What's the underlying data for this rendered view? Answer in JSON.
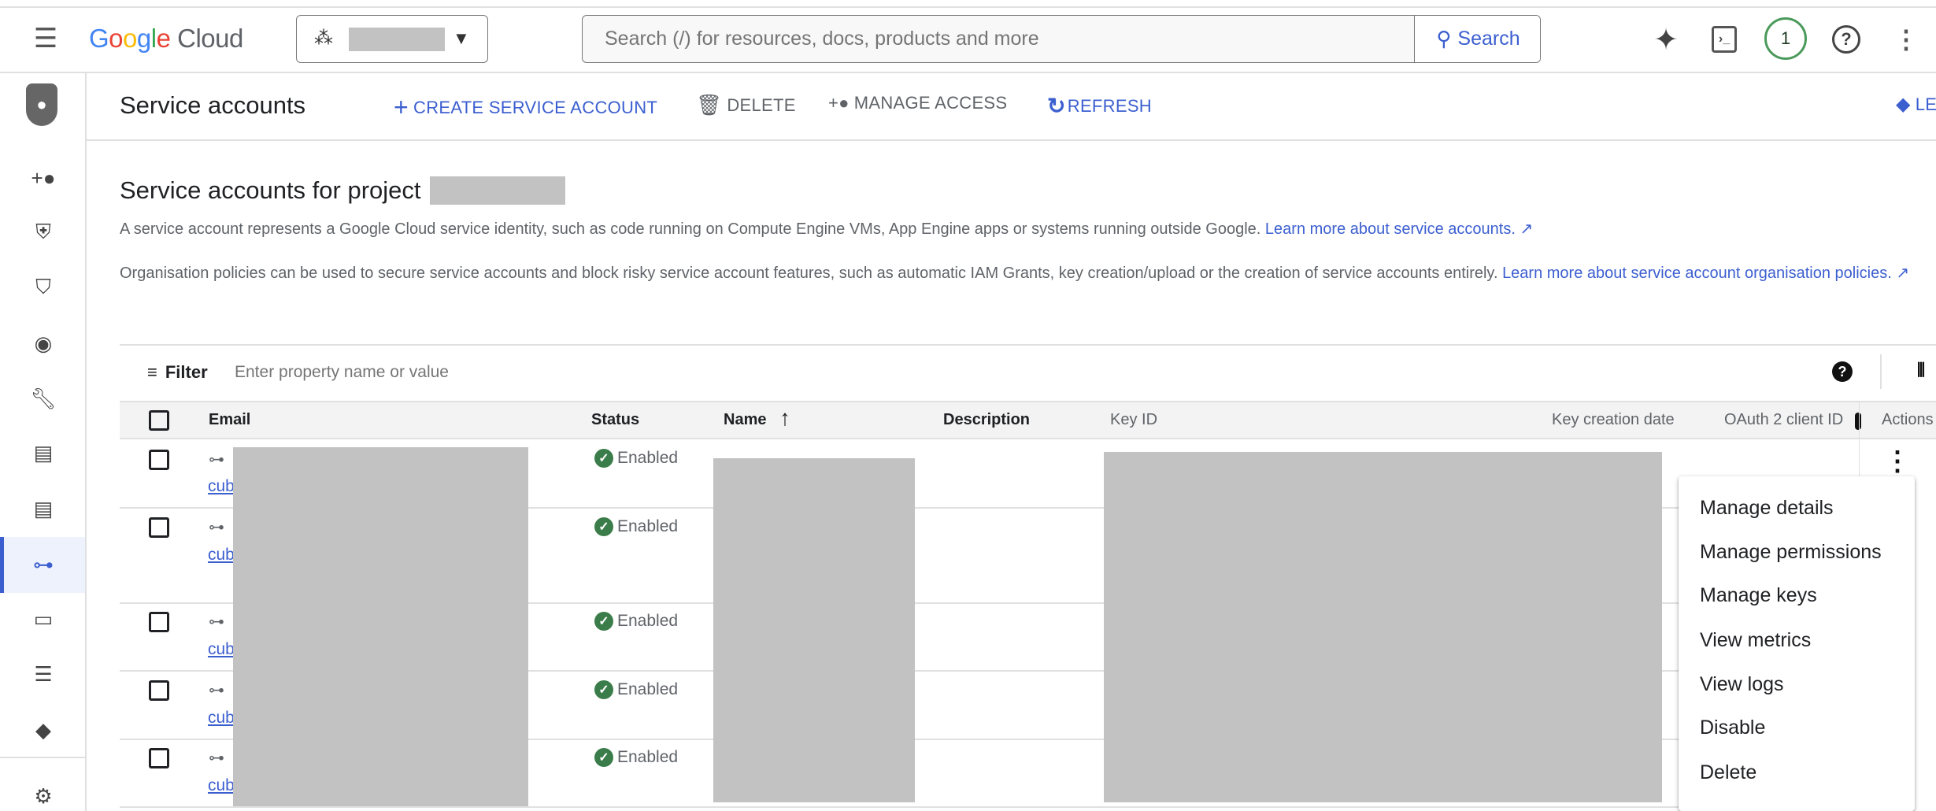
{
  "header": {
    "logo_text": "Google Cloud",
    "search_placeholder": "Search (/) for resources, docs, products and more",
    "search_button": "Search",
    "notification_count": "1"
  },
  "toolbar": {
    "page_title": "Service accounts",
    "create": "CREATE SERVICE ACCOUNT",
    "delete": "DELETE",
    "manage_access": "MANAGE ACCESS",
    "refresh": "REFRESH",
    "learn": "LE"
  },
  "sidebar": {
    "items": [
      {
        "icon": "person-add-icon"
      },
      {
        "icon": "shield-key-icon"
      },
      {
        "icon": "shield-person-icon"
      },
      {
        "icon": "account-circle-icon"
      },
      {
        "icon": "wrench-icon"
      },
      {
        "icon": "document-search-icon"
      },
      {
        "icon": "notes-icon"
      },
      {
        "icon": "service-account-key-icon",
        "active": true
      },
      {
        "icon": "id-card-icon"
      },
      {
        "icon": "list-icon"
      },
      {
        "icon": "tag-icon"
      },
      {
        "icon": "folder-settings-icon"
      }
    ],
    "active_color": "#3c5fd0"
  },
  "main": {
    "heading": "Service accounts for project",
    "para1": "A service account represents a Google Cloud service identity, such as code running on Compute Engine VMs, App Engine apps or systems running outside Google.",
    "para1_link": "Learn more about service accounts.",
    "para2": "Organisation policies can be used to secure service accounts and block risky service account features, such as automatic IAM Grants, key creation/upload or the creation of service accounts entirely.",
    "para2_link_a": "Learn more about service account organisation",
    "para2_link_b": "policies."
  },
  "filter": {
    "label": "Filter",
    "placeholder": "Enter property name or value"
  },
  "table": {
    "columns": [
      "Email",
      "Status",
      "Name",
      "Description",
      "Key ID",
      "Key creation date",
      "OAuth 2 client ID",
      "Actions"
    ],
    "rows": [
      {
        "email_prefix": "cub",
        "status": "Enabled"
      },
      {
        "email_prefix": "cub",
        "status": "Enabled"
      },
      {
        "email_prefix": "cub",
        "status": "Enabled"
      },
      {
        "email_prefix": "cub",
        "status": "Enabled"
      },
      {
        "email_prefix": "cub",
        "status": "Enabled"
      }
    ],
    "status_color": "#3b7d4a"
  },
  "actions_menu": {
    "items": [
      "Manage details",
      "Manage permissions",
      "Manage keys",
      "View metrics",
      "View logs",
      "Disable",
      "Delete"
    ]
  }
}
